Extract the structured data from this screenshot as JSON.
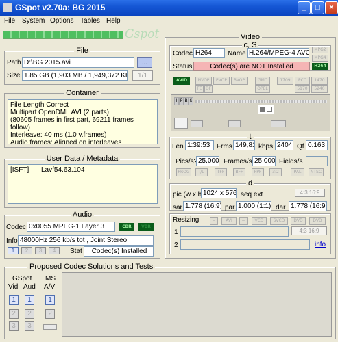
{
  "window": {
    "title": "GSpot v2.70a: BG 2015"
  },
  "menu": [
    "File",
    "System",
    "Options",
    "Tables",
    "Help"
  ],
  "logo": "Gspot",
  "file": {
    "group": "File",
    "path_label": "Path",
    "path_value": "D:\\BG 2015.avi",
    "browse": "...",
    "size_label": "Size",
    "size_value": "1.85 GB (1,903 MB / 1,949,372 KB",
    "page": "1/1"
  },
  "container": {
    "group": "Container",
    "lines": [
      "File Length Correct",
      "Multipart OpenDML AVI (2 parts)",
      "(80605 frames in first part, 69211 frames follow)",
      "Interleave: 40 ms (1.0 v.frames)",
      "Audio frames: Aligned on interleaves"
    ]
  },
  "userdata": {
    "group": "User Data / Metadata",
    "tag": "[ISFT]",
    "value": "Lavf54.63.104"
  },
  "audio": {
    "group": "Audio",
    "codec_label": "Codec",
    "codec_value": "0x0055  MPEG-1 Layer 3",
    "cbr": "CBR",
    "vbr": "VBR",
    "info_label": "Info",
    "info_value": "48000Hz  256 kb/s tot , Joint Stereo",
    "streams": [
      "1",
      "2",
      "3",
      "4"
    ],
    "stat_label": "Stat",
    "stat_value": "Codec(s) Installed"
  },
  "video": {
    "group": "Video",
    "cs_label": "c, S",
    "codec_label": "Codec",
    "codec_value": "H264",
    "name_label": "Name",
    "name_value": "H.264/MPEG-4 AVC",
    "mpg2": "MPG2",
    "mpg4": "MPG4",
    "h264": "H264",
    "status_label": "Status",
    "status_value": "Codec(s) are NOT Installed",
    "flags_row1": [
      "AVID",
      "NVOP",
      "PVOP",
      "BVOP",
      "GMC",
      "1709",
      "PCC",
      "1470"
    ],
    "flags_row2": [
      "FE",
      "DF",
      "OPEL",
      "5170",
      "5240"
    ],
    "frame_types": [
      "I",
      "P",
      "B",
      "S"
    ],
    "t_label": "t",
    "len_label": "Len",
    "len_value": "1:39:53",
    "frms_label": "Frms",
    "frms_value": "149,81",
    "kbps_label": "kbps",
    "kbps_value": "2404",
    "qf_label": "Qf",
    "qf_value": "0.163",
    "pics_label": "Pics/s?",
    "pics_value": "25.000",
    "frames_label": "Frames/s?",
    "frames_value": "25.000",
    "fields_label": "Fields/s",
    "fields_value": "",
    "std_tags": [
      "PROG",
      "I/L",
      "TFF",
      "BFF",
      "PPF",
      "3:2",
      "PAL",
      "NTSC"
    ],
    "d_label": "d",
    "pic_label": "pic (w x h)",
    "pic_value": "1024 x 576",
    "seqext_label": "seq ext",
    "seqext_value": "4:3 16:9",
    "sar_label": "sar",
    "sar_value": "1.778 (16:9)",
    "par_label": "par",
    "par_value": "1.000 (1:1)",
    "dar_label": "dar",
    "dar_value": "1.778 (16:9)",
    "resizing_label": "Resizing",
    "resize_tags": [
      "=",
      "AVI",
      "=",
      "VCD",
      "SVCD",
      "DVD",
      "DVD"
    ],
    "row1": "1",
    "row2": "2",
    "ratio_1": "4:3 16:9",
    "info_link": "info"
  },
  "codec_solutions": {
    "group": "Proposed Codec Solutions and Tests",
    "gspot_label": "GSpot",
    "vid_label": "Vid",
    "aud_label": "Aud",
    "ms_label": "MS",
    "av_label": "A/V",
    "nums": [
      "1",
      "2",
      "3"
    ]
  },
  "colors": {
    "title_bar": "#1557d5",
    "status_bad": "#f5b5b5",
    "flag_on": "#0a5c1a",
    "panel": "#ece9d8",
    "yellow_box": "#ffffe1"
  }
}
